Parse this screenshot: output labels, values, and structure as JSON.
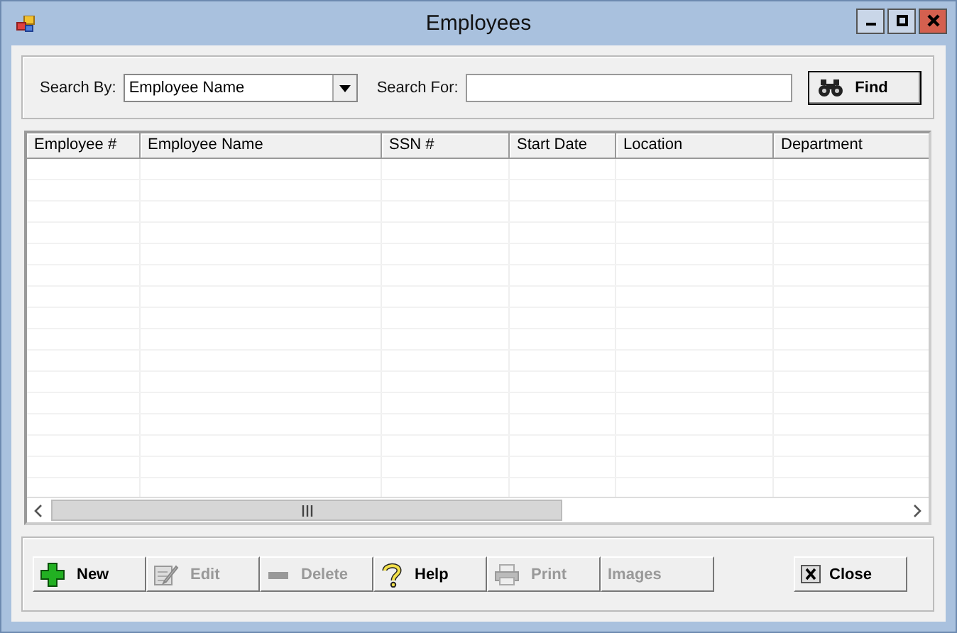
{
  "window": {
    "title": "Employees"
  },
  "search": {
    "by_label": "Search By:",
    "by_value": "Employee Name",
    "for_label": "Search For:",
    "find_button": "Find"
  },
  "table": {
    "columns": [
      "Employee #",
      "Employee Name",
      "SSN #",
      "Start Date",
      "Location",
      "Department"
    ]
  },
  "buttons": [
    {
      "label": "New",
      "kind": "new",
      "disabled": false
    },
    {
      "label": "Edit",
      "kind": "edit",
      "disabled": true
    },
    {
      "label": "Delete",
      "kind": "delete",
      "disabled": true
    },
    {
      "label": "Help",
      "kind": "help",
      "disabled": false
    },
    {
      "label": "Print",
      "kind": "print",
      "disabled": true
    },
    {
      "label": "Images",
      "kind": "none",
      "disabled": true
    },
    {
      "label": "Close",
      "kind": "close",
      "disabled": false
    }
  ]
}
